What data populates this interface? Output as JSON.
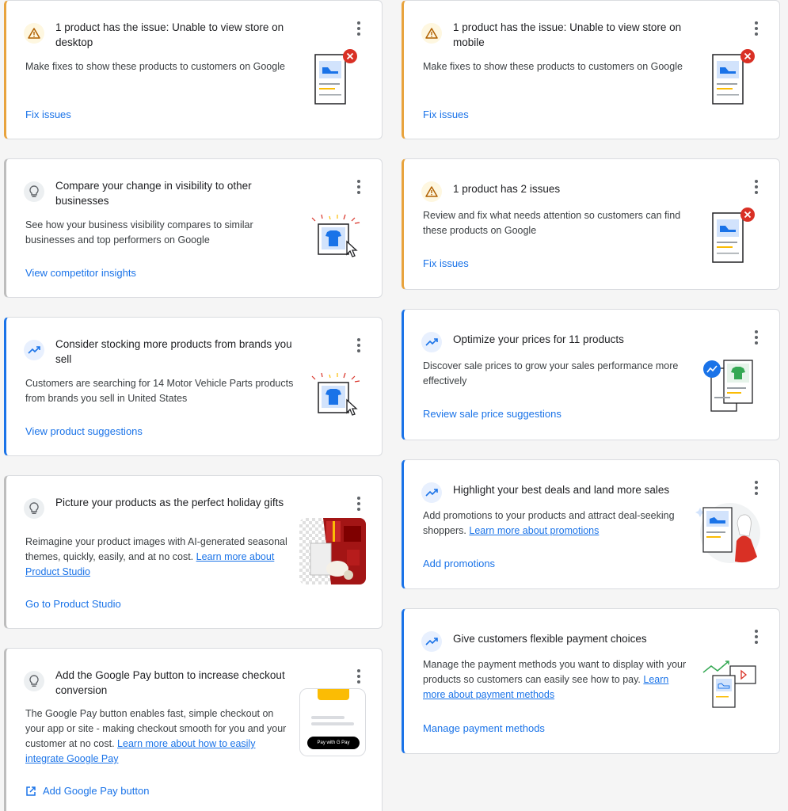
{
  "cards_left": [
    {
      "id": "desktop",
      "type": "warn",
      "title": "1 product has the issue: Unable to view store on desktop",
      "desc": "Make fixes to show these products to customers on Google",
      "action": "Fix issues"
    },
    {
      "id": "visibility",
      "type": "tip",
      "title": "Compare your change in visibility to other businesses",
      "desc": "See how your business visibility compares to similar businesses and top performers on Google",
      "action": "View competitor insights"
    },
    {
      "id": "stocking",
      "type": "trend",
      "title": "Consider stocking more products from brands you sell",
      "desc": "Customers are searching for 14 Motor Vehicle Parts products from brands you sell in United States",
      "action": "View product suggestions"
    },
    {
      "id": "holiday",
      "type": "tip",
      "title": "Picture your products as the perfect holiday gifts",
      "desc": "Reimagine your product images with AI-generated seasonal themes, quickly, easily, and at no cost.",
      "link": "Learn more about Product Studio",
      "action": "Go to Product Studio"
    },
    {
      "id": "gpay",
      "type": "tip",
      "title": "Add the Google Pay button to increase checkout conversion",
      "desc": "The Google Pay button enables fast, simple checkout on your app or site - making checkout smooth for you and your customer at no cost.",
      "link": "Learn more about how to easily integrate Google Pay",
      "action": "Add Google Pay button",
      "gpay_label": "Pay with G Pay"
    }
  ],
  "cards_right": [
    {
      "id": "mobile",
      "type": "warn",
      "title": "1 product has the issue: Unable to view store on mobile",
      "desc": "Make fixes to show these products to customers on Google",
      "action": "Fix issues"
    },
    {
      "id": "two-issues",
      "type": "warn",
      "title": "1 product has 2 issues",
      "desc": "Review and fix what needs attention so customers can find these products on Google",
      "action": "Fix issues"
    },
    {
      "id": "prices",
      "type": "trend",
      "title": "Optimize your prices for 11 products",
      "desc": "Discover sale prices to grow your sales performance more effectively",
      "action": "Review sale price suggestions"
    },
    {
      "id": "deals",
      "type": "trend",
      "title": "Highlight your best deals and land more sales",
      "desc": "Add promotions to your products and attract deal-seeking shoppers.",
      "link": "Learn more about promotions",
      "action": "Add promotions"
    },
    {
      "id": "payments",
      "type": "trend",
      "title": "Give customers flexible payment choices",
      "desc": "Manage the payment methods you want to display with your products so customers can easily see how to pay.",
      "link": "Learn more about payment methods",
      "action": "Manage payment methods"
    }
  ],
  "colors": {
    "accent": "#1a73e8",
    "warning": "#e8a33d",
    "error": "#d93025"
  },
  "icons": {
    "warn": "warning-triangle-icon",
    "tip": "lightbulb-icon",
    "trend": "trending-up-icon",
    "more": "more-vert-icon",
    "external": "open-in-new-icon"
  }
}
